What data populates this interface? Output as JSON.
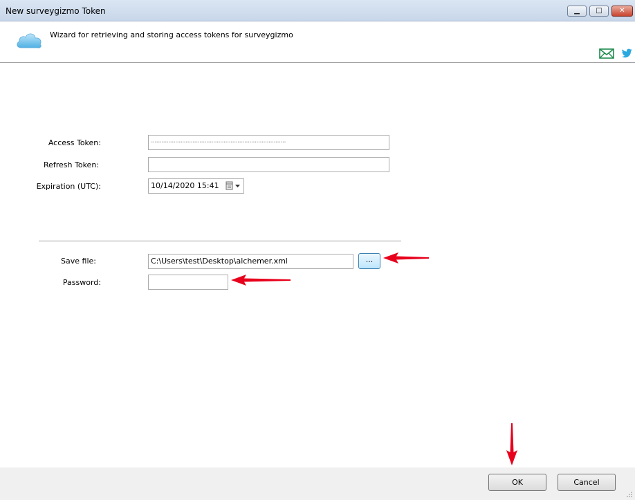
{
  "window": {
    "title": "New surveygizmo Token",
    "minimize_glyph": "▁",
    "maximize_glyph": "□",
    "close_glyph": "✕"
  },
  "header": {
    "description": "Wizard for retrieving and storing access tokens for surveygizmo",
    "icons": [
      "cloud-icon",
      "email-icon",
      "twitter-icon"
    ]
  },
  "form": {
    "access_token_label": "Access Token:",
    "access_token_value": "··············································································",
    "refresh_token_label": "Refresh Token:",
    "refresh_token_value": "",
    "expiration_label": "Expiration (UTC):",
    "expiration_value": "10/14/2020 15:41",
    "save_file_label": "Save file:",
    "save_file_value": "C:\\Users\\test\\Desktop\\alchemer.xml",
    "browse_label": "...",
    "password_label": "Password:",
    "password_value": ""
  },
  "buttons": {
    "ok": "OK",
    "cancel": "Cancel"
  },
  "colors": {
    "annotation_arrow": "#e8001c",
    "email_icon": "#1f8a4c",
    "twitter_icon": "#2aa9e0"
  }
}
